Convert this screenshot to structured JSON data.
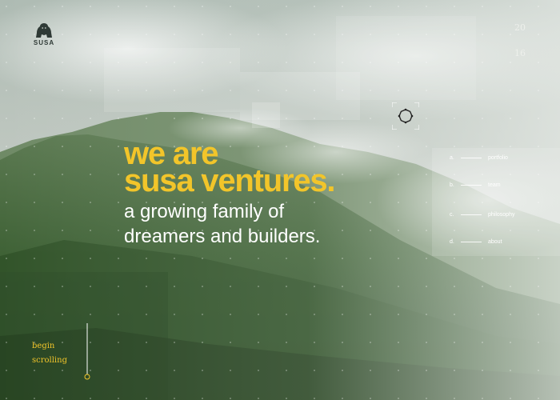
{
  "brand": {
    "name": "SUSA",
    "logo_icon": "gorilla-icon"
  },
  "year": {
    "top": "20",
    "bottom": "16"
  },
  "hero": {
    "line1": "we are",
    "line2": "susa ventures.",
    "tagline1": "a growing family of",
    "tagline2": "dreamers and builders."
  },
  "nav": {
    "items": [
      {
        "letter": "a.",
        "label": "portfolio"
      },
      {
        "letter": "b.",
        "label": "team"
      },
      {
        "letter": "c.",
        "label": "philosophy"
      },
      {
        "letter": "d.",
        "label": "about"
      }
    ]
  },
  "scroll": {
    "line1": "begin",
    "line2": "scrolling"
  },
  "colors": {
    "accent": "#f2c52a",
    "text_light": "#ffffff",
    "logo": "#2f3a36"
  }
}
